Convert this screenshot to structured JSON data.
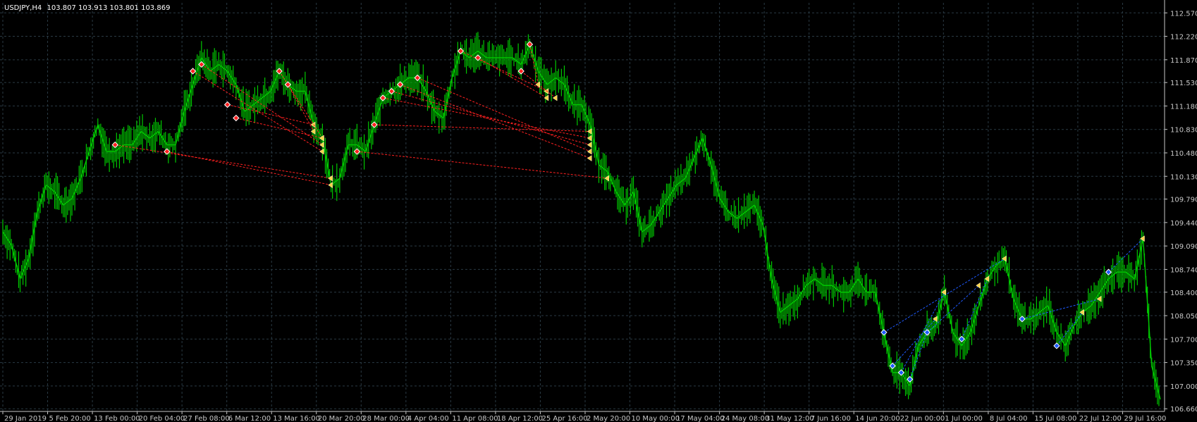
{
  "header": {
    "symbol_timeframe": "USDJPY,H4",
    "ohlc": "103.807 103.913 103.801 103.869"
  },
  "colors": {
    "background": "#000000",
    "grid": "#2a3a44",
    "axis": "#c8c8c8",
    "candle": "#00c800",
    "sell_trade": "#ff2020",
    "buy_trade": "#1e5aff",
    "close_marker": "#ffd24a"
  },
  "chart_data": {
    "type": "line",
    "instrument": "USDJPY",
    "timeframe": "H4",
    "y_ticks": [
      "112.570",
      "112.220",
      "111.870",
      "111.530",
      "111.180",
      "110.830",
      "110.480",
      "110.130",
      "109.790",
      "109.440",
      "109.090",
      "108.740",
      "108.400",
      "108.050",
      "107.700",
      "107.350",
      "107.000",
      "106.660"
    ],
    "ylim": [
      106.62,
      112.72
    ],
    "x_ticks": [
      "29 Jan 2019",
      "5 Feb 20:00",
      "13 Feb 00:00",
      "20 Feb 04:00",
      "27 Feb 08:00",
      "6 Mar 12:00",
      "13 Mar 16:00",
      "20 Mar 20:00",
      "28 Mar 00:00",
      "4 Apr 04:00",
      "11 Apr 08:00",
      "18 Apr 12:00",
      "25 Apr 16:00",
      "2 May 20:00",
      "10 May 00:00",
      "17 May 04:00",
      "24 May 08:00",
      "31 May 12:00",
      "7 Jun 16:00",
      "14 Jun 20:00",
      "22 Jun 00:00",
      "1 Jul 00:00",
      "8 Jul 04:00",
      "15 Jul 08:00",
      "22 Jul 12:00",
      "29 Jul 16:00"
    ],
    "grid": true,
    "price_path": [
      [
        "29 Jan 2019",
        109.3
      ],
      [
        "30 Jan",
        109.1
      ],
      [
        "31 Jan",
        108.6
      ],
      [
        "1 Feb",
        108.9
      ],
      [
        "4 Feb",
        109.6
      ],
      [
        "5 Feb",
        110.0
      ],
      [
        "6 Feb",
        109.9
      ],
      [
        "7 Feb",
        109.7
      ],
      [
        "8 Feb",
        109.8
      ],
      [
        "11 Feb",
        110.1
      ],
      [
        "12 Feb",
        110.5
      ],
      [
        "13 Feb",
        110.9
      ],
      [
        "14 Feb",
        110.5
      ],
      [
        "15 Feb",
        110.5
      ],
      [
        "18 Feb",
        110.6
      ],
      [
        "19 Feb",
        110.6
      ],
      [
        "20 Feb",
        110.8
      ],
      [
        "21 Feb",
        110.7
      ],
      [
        "22 Feb",
        110.8
      ],
      [
        "25 Feb",
        110.6
      ],
      [
        "26 Feb",
        110.6
      ],
      [
        "27 Feb",
        111.1
      ],
      [
        "28 Feb",
        111.5
      ],
      [
        "1 Mar",
        111.9
      ],
      [
        "4 Mar",
        111.7
      ],
      [
        "5 Mar",
        111.8
      ],
      [
        "6 Mar",
        111.7
      ],
      [
        "7 Mar",
        111.5
      ],
      [
        "8 Mar",
        111.1
      ],
      [
        "11 Mar",
        111.2
      ],
      [
        "12 Mar",
        111.3
      ],
      [
        "13 Mar",
        111.4
      ],
      [
        "14 Mar",
        111.7
      ],
      [
        "15 Mar",
        111.5
      ],
      [
        "18 Mar",
        111.4
      ],
      [
        "19 Mar",
        111.4
      ],
      [
        "20 Mar",
        110.9
      ],
      [
        "21 Mar",
        110.7
      ],
      [
        "22 Mar",
        110.0
      ],
      [
        "25 Mar",
        110.1
      ],
      [
        "26 Mar",
        110.6
      ],
      [
        "27 Mar",
        110.6
      ],
      [
        "28 Mar",
        110.5
      ],
      [
        "29 Mar",
        110.9
      ],
      [
        "1 Apr",
        111.3
      ],
      [
        "2 Apr",
        111.4
      ],
      [
        "3 Apr",
        111.5
      ],
      [
        "4 Apr",
        111.6
      ],
      [
        "5 Apr",
        111.6
      ],
      [
        "8 Apr",
        111.4
      ],
      [
        "9 Apr",
        111.1
      ],
      [
        "10 Apr",
        111.0
      ],
      [
        "11 Apr",
        111.6
      ],
      [
        "12 Apr",
        112.0
      ],
      [
        "15 Apr",
        111.9
      ],
      [
        "16 Apr",
        112.0
      ],
      [
        "17 Apr",
        111.9
      ],
      [
        "18 Apr",
        111.9
      ],
      [
        "19 Apr",
        111.9
      ],
      [
        "22 Apr",
        111.9
      ],
      [
        "23 Apr",
        111.8
      ],
      [
        "24 Apr",
        112.1
      ],
      [
        "25 Apr",
        111.7
      ],
      [
        "26 Apr",
        111.5
      ],
      [
        "29 Apr",
        111.6
      ],
      [
        "30 Apr",
        111.5
      ],
      [
        "1 May",
        111.2
      ],
      [
        "2 May",
        111.2
      ],
      [
        "3 May",
        110.9
      ],
      [
        "6 May",
        110.3
      ],
      [
        "7 May",
        110.2
      ],
      [
        "8 May",
        109.9
      ],
      [
        "9 May",
        109.7
      ],
      [
        "10 May",
        109.9
      ],
      [
        "13 May",
        109.3
      ],
      [
        "14 May",
        109.4
      ],
      [
        "15 May",
        109.6
      ],
      [
        "16 May",
        109.8
      ],
      [
        "17 May",
        110.0
      ],
      [
        "20 May",
        110.1
      ],
      [
        "21 May",
        110.4
      ],
      [
        "22 May",
        110.7
      ],
      [
        "23 May",
        110.3
      ],
      [
        "24 May",
        109.8
      ],
      [
        "27 May",
        109.6
      ],
      [
        "28 May",
        109.5
      ],
      [
        "29 May",
        109.6
      ],
      [
        "30 May",
        109.7
      ],
      [
        "31 May",
        109.4
      ],
      [
        "3 Jun",
        108.6
      ],
      [
        "4 Jun",
        108.1
      ],
      [
        "5 Jun",
        108.2
      ],
      [
        "6 Jun",
        108.3
      ],
      [
        "7 Jun",
        108.5
      ],
      [
        "10 Jun",
        108.6
      ],
      [
        "11 Jun",
        108.5
      ],
      [
        "12 Jun",
        108.5
      ],
      [
        "13 Jun",
        108.4
      ],
      [
        "14 Jun",
        108.4
      ],
      [
        "17 Jun",
        108.6
      ],
      [
        "18 Jun",
        108.4
      ],
      [
        "19 Jun",
        108.4
      ],
      [
        "20 Jun",
        107.8
      ],
      [
        "21 Jun",
        107.2
      ],
      [
        "24 Jun",
        107.2
      ],
      [
        "25 Jun",
        107.0
      ],
      [
        "26 Jun",
        107.6
      ],
      [
        "27 Jun",
        107.8
      ],
      [
        "28 Jun",
        107.9
      ],
      [
        "1 Jul",
        108.4
      ],
      [
        "2 Jul",
        107.8
      ],
      [
        "3 Jul",
        107.6
      ],
      [
        "4 Jul",
        107.8
      ],
      [
        "5 Jul",
        108.2
      ],
      [
        "8 Jul",
        108.6
      ],
      [
        "9 Jul",
        108.8
      ],
      [
        "10 Jul",
        108.9
      ],
      [
        "11 Jul",
        108.3
      ],
      [
        "12 Jul",
        108.0
      ],
      [
        "15 Jul",
        108.0
      ],
      [
        "16 Jul",
        108.1
      ],
      [
        "17 Jul",
        108.2
      ],
      [
        "18 Jul",
        107.8
      ],
      [
        "19 Jul",
        107.6
      ],
      [
        "22 Jul",
        107.9
      ],
      [
        "23 Jul",
        108.1
      ],
      [
        "24 Jul",
        108.2
      ],
      [
        "25 Jul",
        108.4
      ],
      [
        "26 Jul",
        108.6
      ],
      [
        "29 Jul",
        108.7
      ],
      [
        "30 Jul",
        108.7
      ],
      [
        "31 Jul",
        108.6
      ],
      [
        "1 Aug",
        109.2
      ],
      [
        "2 Aug",
        107.3
      ],
      [
        "5 Aug",
        106.8
      ]
    ],
    "trades": [
      {
        "side": "sell",
        "open": [
          "15 Feb",
          110.6
        ],
        "close": [
          "22 Mar",
          110.1
        ]
      },
      {
        "side": "sell",
        "open": [
          "25 Feb",
          110.5
        ],
        "close": [
          "22 Mar",
          110.0
        ]
      },
      {
        "side": "sell",
        "open": [
          "28 Feb",
          111.7
        ],
        "close": [
          "21 Mar",
          110.5
        ]
      },
      {
        "side": "sell",
        "open": [
          "1 Mar",
          111.8
        ],
        "close": [
          "21 Mar",
          110.6
        ]
      },
      {
        "side": "sell",
        "open": [
          "6 Mar",
          111.2
        ],
        "close": [
          "20 Mar",
          110.9
        ]
      },
      {
        "side": "sell",
        "open": [
          "7 Mar",
          111.0
        ],
        "close": [
          "21 Mar",
          110.7
        ]
      },
      {
        "side": "sell",
        "open": [
          "14 Mar",
          111.7
        ],
        "close": [
          "21 Mar",
          110.7
        ]
      },
      {
        "side": "sell",
        "open": [
          "15 Mar",
          111.5
        ],
        "close": [
          "20 Mar",
          110.8
        ]
      },
      {
        "side": "sell",
        "open": [
          "27 Mar",
          110.5
        ],
        "close": [
          "7 May",
          110.1
        ]
      },
      {
        "side": "sell",
        "open": [
          "29 Mar",
          110.9
        ],
        "close": [
          "3 May",
          110.8
        ]
      },
      {
        "side": "sell",
        "open": [
          "1 Apr",
          111.3
        ],
        "close": [
          "3 May",
          110.7
        ]
      },
      {
        "side": "sell",
        "open": [
          "2 Apr",
          111.4
        ],
        "close": [
          "3 May",
          110.6
        ]
      },
      {
        "side": "sell",
        "open": [
          "3 Apr",
          111.5
        ],
        "close": [
          "3 May",
          110.4
        ]
      },
      {
        "side": "sell",
        "open": [
          "5 Apr",
          111.6
        ],
        "close": [
          "3 May",
          110.5
        ]
      },
      {
        "side": "sell",
        "open": [
          "12 Apr",
          112.0
        ],
        "close": [
          "26 Apr",
          111.4
        ]
      },
      {
        "side": "sell",
        "open": [
          "16 Apr",
          111.9
        ],
        "close": [
          "26 Apr",
          111.3
        ]
      },
      {
        "side": "sell",
        "open": [
          "23 Apr",
          111.7
        ],
        "close": [
          "29 Apr",
          111.3
        ]
      },
      {
        "side": "sell",
        "open": [
          "24 Apr",
          112.1
        ],
        "close": [
          "25 Apr",
          111.5
        ]
      },
      {
        "side": "buy",
        "open": [
          "20 Jun",
          107.8
        ],
        "close": [
          "10 Jul",
          108.9
        ]
      },
      {
        "side": "buy",
        "open": [
          "21 Jun",
          107.3
        ],
        "close": [
          "28 Jun",
          108.0
        ]
      },
      {
        "side": "buy",
        "open": [
          "24 Jun",
          107.2
        ],
        "close": [
          "1 Jul",
          108.4
        ]
      },
      {
        "side": "buy",
        "open": [
          "25 Jun",
          107.1
        ],
        "close": [
          "27 Jun",
          107.8
        ]
      },
      {
        "side": "buy",
        "open": [
          "27 Jun",
          107.8
        ],
        "close": [
          "5 Jul",
          108.5
        ]
      },
      {
        "side": "buy",
        "open": [
          "3 Jul",
          107.7
        ],
        "close": [
          "8 Jul",
          108.6
        ]
      },
      {
        "side": "buy",
        "open": [
          "12 Jul",
          108.0
        ],
        "close": [
          "25 Jul",
          108.3
        ]
      },
      {
        "side": "buy",
        "open": [
          "18 Jul",
          107.6
        ],
        "close": [
          "23 Jul",
          108.1
        ]
      },
      {
        "side": "buy",
        "open": [
          "26 Jul",
          108.7
        ],
        "close": [
          "1 Aug",
          109.2
        ]
      }
    ]
  }
}
